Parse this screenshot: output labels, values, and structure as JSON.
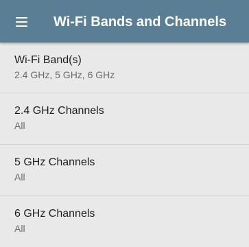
{
  "header": {
    "title": "Wi-Fi Bands and Channels",
    "menu_icon": "hamburger-menu-icon"
  },
  "colors": {
    "header_background": "#5a7f95",
    "header_text": "#ffffff",
    "page_background": "#e9e9e9",
    "primary_text": "#1f1f1f",
    "secondary_text": "#6b6b6b",
    "divider": "#cfcfcf"
  },
  "settings": [
    {
      "label": "Wi-Fi Band(s)",
      "value": "2.4 GHz, 5 GHz, 6 GHz"
    },
    {
      "label": "2.4 GHz Channels",
      "value": "All"
    },
    {
      "label": "5 GHz Channels",
      "value": "All"
    },
    {
      "label": "6 GHz Channels",
      "value": "All"
    }
  ]
}
